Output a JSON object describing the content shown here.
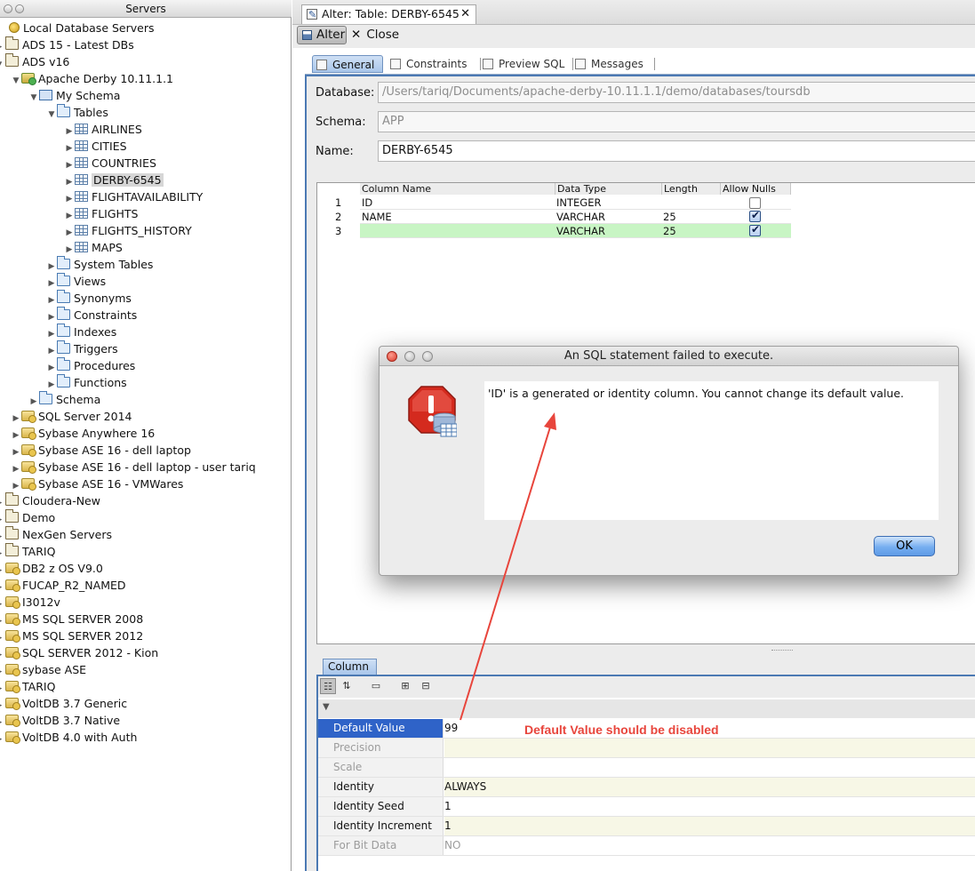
{
  "servers_panel": {
    "title": "Servers",
    "tree": [
      {
        "label": "Local Database Servers",
        "icon": "server-icon",
        "arrow": "",
        "indent": 0
      },
      {
        "label": "ADS 15 - Latest DBs",
        "icon": "folder-icon",
        "arrow": "▸",
        "indent": 1
      },
      {
        "label": "ADS v16",
        "icon": "folder-icon",
        "arrow": "▾",
        "indent": 1
      },
      {
        "label": "Apache Derby 10.11.1.1",
        "icon": "database-connected-icon",
        "arrow": "▼",
        "indent": 2
      },
      {
        "label": "My Schema",
        "icon": "schema-icon",
        "arrow": "▼",
        "indent": 3
      },
      {
        "label": "Tables",
        "icon": "folder-icon",
        "arrow": "▼",
        "indent": 4
      },
      {
        "label": "AIRLINES",
        "icon": "table-icon",
        "arrow": "▶",
        "indent": 5
      },
      {
        "label": "CITIES",
        "icon": "table-icon",
        "arrow": "▶",
        "indent": 5
      },
      {
        "label": "COUNTRIES",
        "icon": "table-icon",
        "arrow": "▶",
        "indent": 5
      },
      {
        "label": "DERBY-6545",
        "icon": "table-icon",
        "arrow": "▶",
        "indent": 5,
        "selected": true
      },
      {
        "label": "FLIGHTAVAILABILITY",
        "icon": "table-icon",
        "arrow": "▶",
        "indent": 5
      },
      {
        "label": "FLIGHTS",
        "icon": "table-icon",
        "arrow": "▶",
        "indent": 5
      },
      {
        "label": "FLIGHTS_HISTORY",
        "icon": "table-icon",
        "arrow": "▶",
        "indent": 5
      },
      {
        "label": "MAPS",
        "icon": "table-icon",
        "arrow": "▶",
        "indent": 5
      },
      {
        "label": "System Tables",
        "icon": "folder-icon",
        "arrow": "▶",
        "indent": 4
      },
      {
        "label": "Views",
        "icon": "folder-icon",
        "arrow": "▶",
        "indent": 4
      },
      {
        "label": "Synonyms",
        "icon": "folder-icon",
        "arrow": "▶",
        "indent": 4
      },
      {
        "label": "Constraints",
        "icon": "folder-icon",
        "arrow": "▶",
        "indent": 4
      },
      {
        "label": "Indexes",
        "icon": "folder-icon",
        "arrow": "▶",
        "indent": 4
      },
      {
        "label": "Triggers",
        "icon": "folder-icon",
        "arrow": "▶",
        "indent": 4
      },
      {
        "label": "Procedures",
        "icon": "folder-icon",
        "arrow": "▶",
        "indent": 4
      },
      {
        "label": "Functions",
        "icon": "folder-icon",
        "arrow": "▶",
        "indent": 4
      },
      {
        "label": "Schema",
        "icon": "folder-icon",
        "arrow": "▶",
        "indent": 3
      },
      {
        "label": "SQL Server 2014",
        "icon": "database-icon",
        "arrow": "▶",
        "indent": 2
      },
      {
        "label": "Sybase Anywhere 16",
        "icon": "database-icon",
        "arrow": "▶",
        "indent": 2
      },
      {
        "label": "Sybase ASE 16 - dell laptop",
        "icon": "database-icon",
        "arrow": "▶",
        "indent": 2
      },
      {
        "label": "Sybase ASE 16 - dell laptop - user tariq",
        "icon": "database-icon",
        "arrow": "▶",
        "indent": 2
      },
      {
        "label": "Sybase ASE 16 - VMWares",
        "icon": "database-icon",
        "arrow": "▶",
        "indent": 2
      },
      {
        "label": "Cloudera-New",
        "icon": "folder-icon",
        "arrow": "▸",
        "indent": 1
      },
      {
        "label": "Demo",
        "icon": "folder-icon",
        "arrow": "▸",
        "indent": 1
      },
      {
        "label": "NexGen Servers",
        "icon": "folder-icon",
        "arrow": "▸",
        "indent": 1
      },
      {
        "label": "TARIQ",
        "icon": "folder-icon",
        "arrow": "▸",
        "indent": 1
      },
      {
        "label": "DB2 z OS V9.0",
        "icon": "database-icon",
        "arrow": "▸",
        "indent": 1
      },
      {
        "label": "FUCAP_R2_NAMED",
        "icon": "database-icon",
        "arrow": "▸",
        "indent": 1
      },
      {
        "label": "I3012v",
        "icon": "database-icon",
        "arrow": "▸",
        "indent": 1
      },
      {
        "label": "MS SQL SERVER 2008",
        "icon": "database-icon",
        "arrow": "▸",
        "indent": 1
      },
      {
        "label": "MS SQL SERVER 2012",
        "icon": "database-icon",
        "arrow": "▸",
        "indent": 1
      },
      {
        "label": "SQL SERVER 2012 - Kion",
        "icon": "database-icon",
        "arrow": "▸",
        "indent": 1
      },
      {
        "label": "sybase ASE",
        "icon": "database-icon",
        "arrow": "▸",
        "indent": 1
      },
      {
        "label": "TARIQ",
        "icon": "database-icon",
        "arrow": "▸",
        "indent": 1
      },
      {
        "label": "VoltDB 3.7 Generic",
        "icon": "database-icon",
        "arrow": "▸",
        "indent": 1
      },
      {
        "label": "VoltDB 3.7 Native",
        "icon": "database-icon",
        "arrow": "▸",
        "indent": 1
      },
      {
        "label": "VoltDB 4.0 with Auth",
        "icon": "database-icon",
        "arrow": "▸",
        "indent": 1
      }
    ]
  },
  "editor_tab": {
    "label": "Alter: Table: DERBY-6545",
    "close": "✕"
  },
  "toolbar": {
    "alter_label": "Alter",
    "close_label": "Close",
    "close_glyph": "✕"
  },
  "subtabs": [
    {
      "label": "General",
      "icon": "general-icon",
      "active": true
    },
    {
      "label": "Constraints",
      "icon": "constraints-icon"
    },
    {
      "label": "Preview SQL",
      "icon": "preview-sql-icon"
    },
    {
      "label": "Messages",
      "icon": "messages-icon"
    }
  ],
  "form": {
    "database_label": "Database:",
    "database_value": "/Users/tariq/Documents/apache-derby-10.11.1.1/demo/databases/toursdb",
    "schema_label": "Schema:",
    "schema_value": "APP",
    "name_label": "Name:",
    "name_value": "DERBY-6545"
  },
  "columns_grid": {
    "headers": [
      "Column Name",
      "Data Type",
      "Length",
      "Allow Nulls"
    ],
    "rows": [
      {
        "num": "1",
        "name": "ID",
        "type": "INTEGER",
        "length": "",
        "allow_nulls": false
      },
      {
        "num": "2",
        "name": "NAME",
        "type": "VARCHAR",
        "length": "25",
        "allow_nulls": true
      },
      {
        "num": "3",
        "name": "",
        "type": "VARCHAR",
        "length": "25",
        "allow_nulls": true,
        "new": true
      }
    ]
  },
  "column_panel": {
    "tab_label": "Column",
    "tools": [
      "categorized-icon",
      "sort-az-icon",
      "properties-icon",
      "expand-icon",
      "collapse-icon"
    ],
    "properties": [
      {
        "key": "Default Value",
        "value": "99",
        "selected": true
      },
      {
        "key": "Precision",
        "value": "",
        "disabled": true
      },
      {
        "key": "Scale",
        "value": "",
        "disabled": true
      },
      {
        "key": "Identity",
        "value": "ALWAYS"
      },
      {
        "key": "Identity Seed",
        "value": "1"
      },
      {
        "key": "Identity Increment",
        "value": "1"
      },
      {
        "key": "For Bit Data",
        "value": "NO",
        "disabled": true
      }
    ]
  },
  "annotation": {
    "text": "Default Value should be disabled",
    "color": "#e8453c"
  },
  "dialog": {
    "title": "An SQL statement failed to execute.",
    "message": "'ID' is a generated or identity column. You cannot change its default value.",
    "ok_label": "OK",
    "icon": "stop-error-icon"
  },
  "colors": {
    "accent": "#4b79b3",
    "selection": "#2f63c8",
    "new_row": "#c8f5c4"
  }
}
